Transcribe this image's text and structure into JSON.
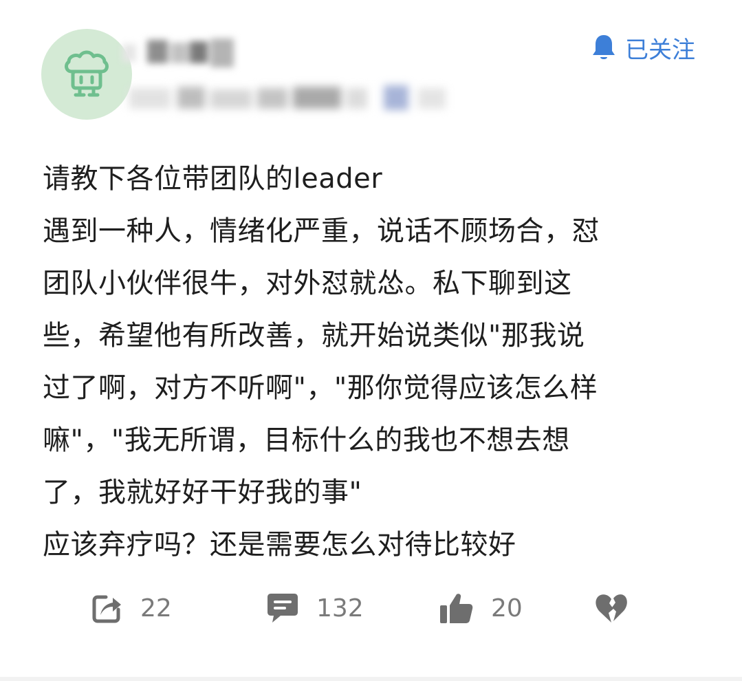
{
  "header": {
    "follow_label": "已关注"
  },
  "post": {
    "lines": [
      "请教下各位带团队的leader",
      "遇到一种人，情绪化严重，说话不顾场合，怼",
      "团队小伙伴很牛，对外怼就怂。私下聊到这",
      "些，希望他有所改善，就开始说类似\"那我说",
      "过了啊，对方不听啊\"，\"那你觉得应该怎么样",
      "嘛\"，\"我无所谓，目标什么的我也不想去想",
      "了，我就好好干好我的事\"",
      "应该弃疗吗？还是需要怎么对待比较好"
    ]
  },
  "actions": {
    "share_count": "22",
    "comment_count": "132",
    "like_count": "20"
  },
  "colors": {
    "accent": "#3d7fd8",
    "avatar_bg": "#d4ead5",
    "avatar_icon": "#6fbf8e",
    "icon_gray": "#6e6e6e",
    "text": "#1e1e1e"
  }
}
